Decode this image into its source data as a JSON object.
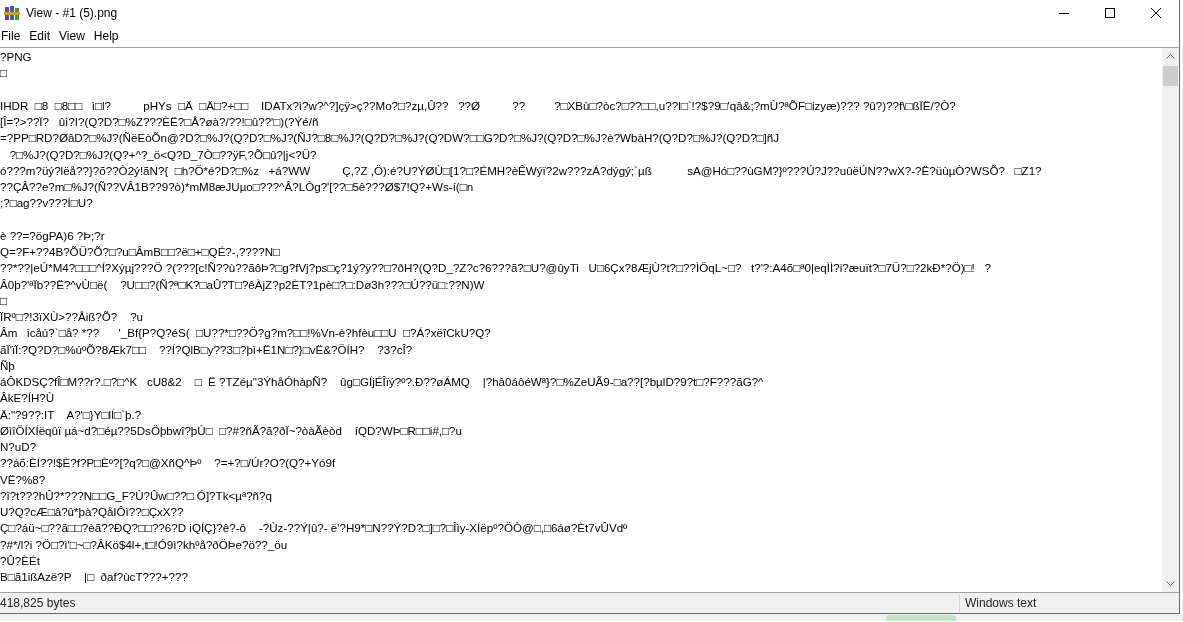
{
  "window": {
    "title": "View - #1 (5).png"
  },
  "menu": [
    "File",
    "Edit",
    "View",
    "Help"
  ],
  "blocks": [
    [
      "?PNG",
      "□"
    ],
    [
      "IHDR  □8  □8□□   ì□l?          pHYs  □Ä  □Ä□?+□□    IDATx?ì?w?^?]çÿ>ç??Mo?□?zµ,Û??   ??Ø          ??         ?□XBù□?òc?□??□□,u??l□`!?$?9□'qâ&;?mÙ?ªÕF□izyæ)??? ?û?)??f\\□ßÏË/?Ò?",
      "[Î=?>??Ï?   ûì?I?(Q?D?□%Z???ÈË?□Å?øà?/??!□û??'□)(?Ýé/ñ",
      "=?PP□RD?ØâD?□%J?(ÑëEòÕn@?D?□%J?(Q?D?□%J?(ÑJ?□8□%J?(Q?D?□%J?(Q?DW?□□G?D?□%J?(Q?D?□%J?è?WbàH?(Q?D?□%J?(Q?D?□]ñJ",
      "   ?□%J?(Q?D?□%J?(Q?+^?_ö<Q?D_7Ò□??ÿF,?Õ□û?|j<?Ü?",
      "ó???m?üý?lëå??}?õ??Ò2ý!ãN?{  □h?Ö*é?D?□%z   +á?WW          Ç,?Z ,Ö):é?U?ÝØÙ□[1?□?ÉMH?èÊWýï?2w???zÁ?dýgý;`µß           sA@Hó□??ùGM?}º???Ú?J??uûëÚN??wX?-?Ë?üùµÒ?WSÕ?   □Z1?",
      "??ÇÂ??e?m□%J?(Ñ??VÂ1B??9?ò)*mM8æJUµo□???^Â?LÒg?'[??□5ê???Ø$7!Q?+Ws-í(□n",
      ";?□ag??v???Í□U?"
    ],
    [
      "è ??=?ögPA)6 ?Þ;?r",
      "Q=?F+??4B?ÕÜ?Õ?□?u□ÂmB□□?ë□+□QÉ?-,????N□",
      "??*??|eÚ*M4?□□□^Í?Xýµj???Ö ?(???[c!Ñ??ù??ãôÞ?□g?fVj?ps□ç?1ý?ÿ??□?ðH?(Q?D_?Z?c?6???ã?□U?@ûyTi   U□6Çx?8ÆjÙ?t?□??ÌÖqL~□?   t?'?:A4õ□ª0|eqÌÌ?i?æuït?□7Ü?□?2kÐ*?Ö)□!   ?",
      "Â0þ?'ªÏb??Ë?^vÙ□ë(    ?U□□?(Ñ?ª□K?□aÛ?T□?êÀjZ?p2ÈT?1pè□?□:Dø3h???□Ú??ü□:??N)W",
      "□",
      "ÏRº□?!3ïXÙ>??Åiß?Õ?    ?u",
      "Âm   icåú?`□å? *??      '_Bf{P?Q?éS(  □U??*□??Ö?g?m?□□!%Vn-è?hfèu□□U  □?Á?xëîCkU?Q?",
      "ãÏ'ïÏ:?Q?D?□%úºÕ?8Æk7□□    ??Í?QlB□y??3□?þì+Ë1N□?}□vË&?ÖÍH?    ?3?cÎ?",
      "Ñþ",
      "áÔKDSÇ?fÎ□M??r?.□?□^K   cU8&2    □  Ë ?TZéµ\"3ÝhåÓhàpÑ?    ûg□GÍjÉÎïý?º?.Ð??øÁMQ    |?hâ0áôéWª}?□%ZeUÃ9-□a??[?bµlD?9?t□?F???ãG?^",
      "ÂkE?ÍH?Ù",
      "Ä:\"?9??:IT    A?'□}Y□lÍ□`þ.?",
      "ØìîÖÍXÍëqûï µá~d?□éµ??5DsÖþbwî?þÙ□  □?#?ñÃ?ã?ðÏ~?òàÃèòd    íQD?WÞ□R□□i#,□?u",
      "N?uD?",
      "??áõ:ÈÍ??!$È?f?P□Èº?[?q?□@XñQ^Þº    ?=+?□/Úr?O?(Q?+Yó9f",
      "VË?%8?",
      "?î?t???hÛ?*???N□□G_F?Ù?Ûw□??□ Ó]?Tk<µª?ñ?q",
      "U?Q?cÆ□â?û*þà?QåIÔì??□ÇxX??",
      "Ç□?áü~□??ã□□?èã??ÐQ?□□??6?D iQÍÇ}?ê?-ô    -?Ùz-??Ý|û?- ë'?H9*□N??Ý?D?□]□?□Îìy-XÍëpº?ÖÒ@□,□6áø?Èt7vÛVdº",
      "?#*/l?i ?Ö□?ì'□~□?ÂKö$4l+,t□!Ó9ì?khºå?ðÖÞe?ö??_öu",
      "?Û?ÈÉt",
      "B□ã1ißAzë?P    |□  ðaf?ùcT???+???"
    ]
  ],
  "status_bar": {
    "size": "418,825 bytes",
    "encoding": "Windows text"
  }
}
